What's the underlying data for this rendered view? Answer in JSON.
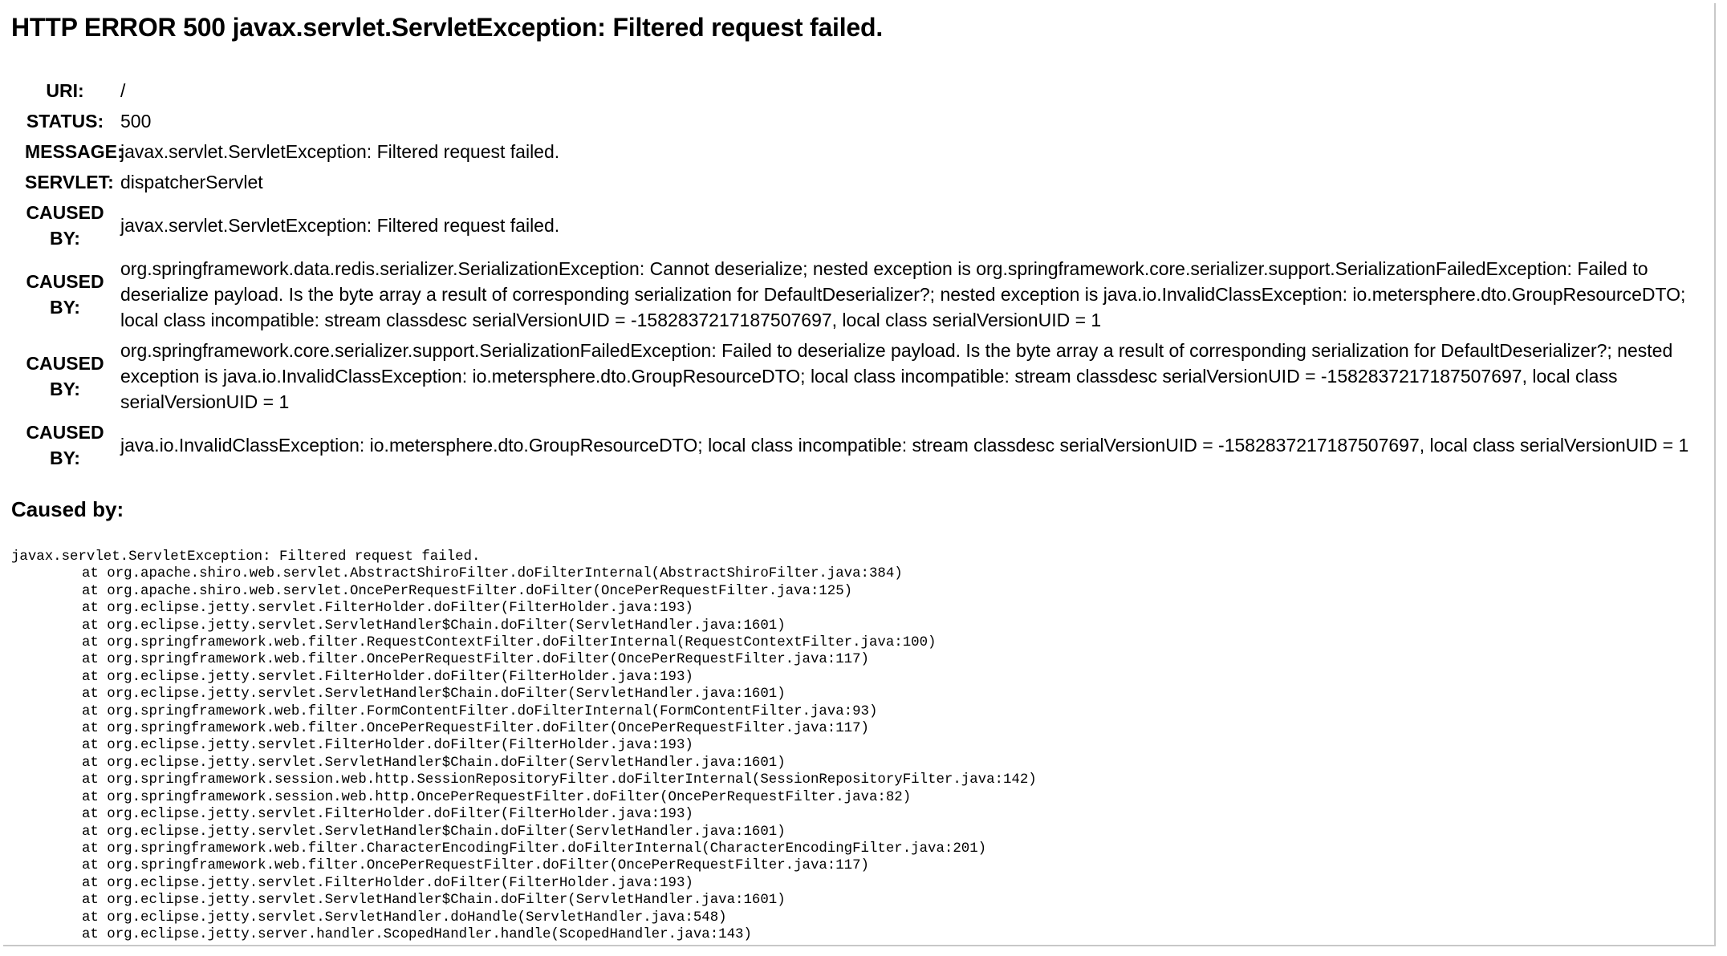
{
  "title": "HTTP ERROR 500 javax.servlet.ServletException: Filtered request failed.",
  "info_rows": [
    {
      "label": "URI:",
      "value": "/"
    },
    {
      "label": "STATUS:",
      "value": "500"
    },
    {
      "label": "MESSAGE:",
      "value": "javax.servlet.ServletException: Filtered request failed."
    },
    {
      "label": "SERVLET:",
      "value": "dispatcherServlet"
    },
    {
      "label": "CAUSED BY:",
      "value": "javax.servlet.ServletException: Filtered request failed."
    },
    {
      "label": "CAUSED BY:",
      "value": "org.springframework.data.redis.serializer.SerializationException: Cannot deserialize; nested exception is org.springframework.core.serializer.support.SerializationFailedException: Failed to deserialize payload. Is the byte array a result of corresponding serialization for DefaultDeserializer?; nested exception is java.io.InvalidClassException: io.metersphere.dto.GroupResourceDTO; local class incompatible: stream classdesc serialVersionUID = -1582837217187507697, local class serialVersionUID = 1"
    },
    {
      "label": "CAUSED BY:",
      "value": "org.springframework.core.serializer.support.SerializationFailedException: Failed to deserialize payload. Is the byte array a result of corresponding serialization for DefaultDeserializer?; nested exception is java.io.InvalidClassException: io.metersphere.dto.GroupResourceDTO; local class incompatible: stream classdesc serialVersionUID = -1582837217187507697, local class serialVersionUID = 1"
    },
    {
      "label": "CAUSED BY:",
      "value": "java.io.InvalidClassException: io.metersphere.dto.GroupResourceDTO; local class incompatible: stream classdesc serialVersionUID = -1582837217187507697, local class serialVersionUID = 1"
    }
  ],
  "caused_by_heading": "Caused by:",
  "stack_trace": [
    "javax.servlet.ServletException: Filtered request failed.",
    "at org.apache.shiro.web.servlet.AbstractShiroFilter.doFilterInternal(AbstractShiroFilter.java:384)",
    "at org.apache.shiro.web.servlet.OncePerRequestFilter.doFilter(OncePerRequestFilter.java:125)",
    "at org.eclipse.jetty.servlet.FilterHolder.doFilter(FilterHolder.java:193)",
    "at org.eclipse.jetty.servlet.ServletHandler$Chain.doFilter(ServletHandler.java:1601)",
    "at org.springframework.web.filter.RequestContextFilter.doFilterInternal(RequestContextFilter.java:100)",
    "at org.springframework.web.filter.OncePerRequestFilter.doFilter(OncePerRequestFilter.java:117)",
    "at org.eclipse.jetty.servlet.FilterHolder.doFilter(FilterHolder.java:193)",
    "at org.eclipse.jetty.servlet.ServletHandler$Chain.doFilter(ServletHandler.java:1601)",
    "at org.springframework.web.filter.FormContentFilter.doFilterInternal(FormContentFilter.java:93)",
    "at org.springframework.web.filter.OncePerRequestFilter.doFilter(OncePerRequestFilter.java:117)",
    "at org.eclipse.jetty.servlet.FilterHolder.doFilter(FilterHolder.java:193)",
    "at org.eclipse.jetty.servlet.ServletHandler$Chain.doFilter(ServletHandler.java:1601)",
    "at org.springframework.session.web.http.SessionRepositoryFilter.doFilterInternal(SessionRepositoryFilter.java:142)",
    "at org.springframework.session.web.http.OncePerRequestFilter.doFilter(OncePerRequestFilter.java:82)",
    "at org.eclipse.jetty.servlet.FilterHolder.doFilter(FilterHolder.java:193)",
    "at org.eclipse.jetty.servlet.ServletHandler$Chain.doFilter(ServletHandler.java:1601)",
    "at org.springframework.web.filter.CharacterEncodingFilter.doFilterInternal(CharacterEncodingFilter.java:201)",
    "at org.springframework.web.filter.OncePerRequestFilter.doFilter(OncePerRequestFilter.java:117)",
    "at org.eclipse.jetty.servlet.FilterHolder.doFilter(FilterHolder.java:193)",
    "at org.eclipse.jetty.servlet.ServletHandler$Chain.doFilter(ServletHandler.java:1601)",
    "at org.eclipse.jetty.servlet.ServletHandler.doHandle(ServletHandler.java:548)",
    "at org.eclipse.jetty.server.handler.ScopedHandler.handle(ScopedHandler.java:143)"
  ]
}
